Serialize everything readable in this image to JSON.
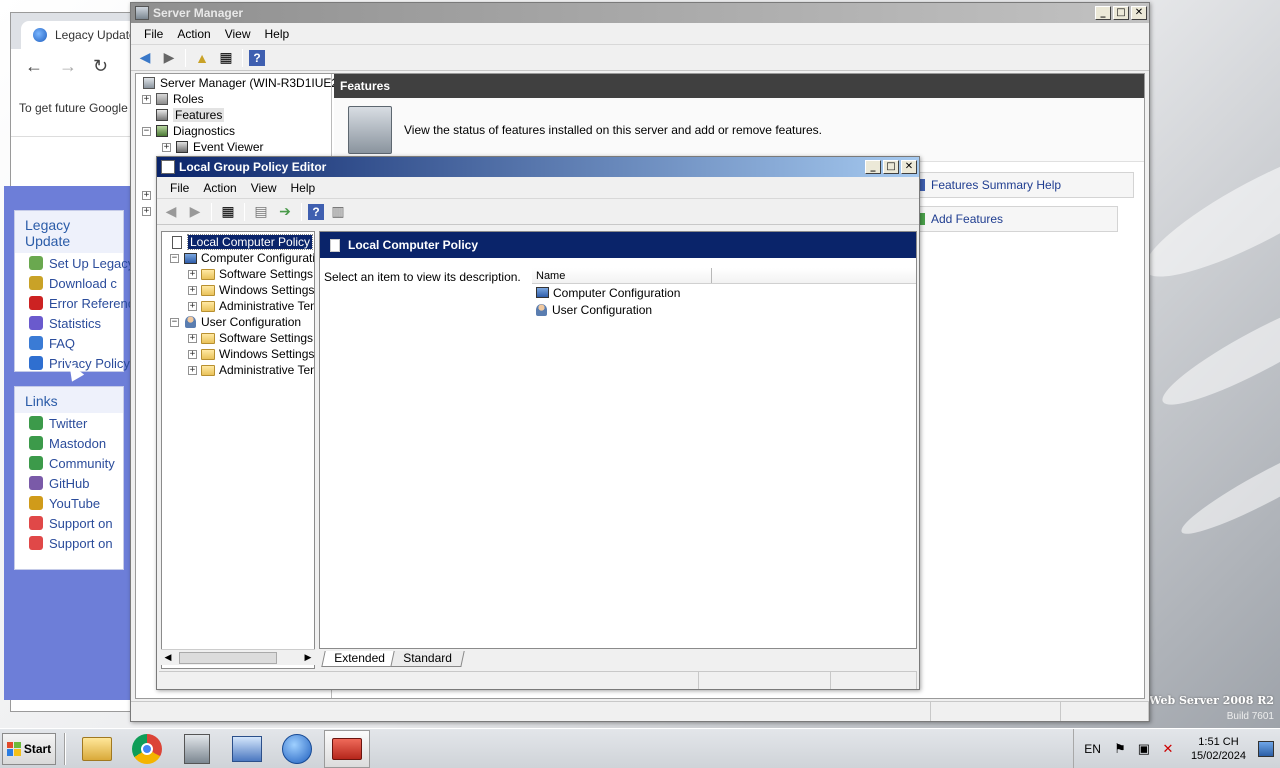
{
  "browser": {
    "tab_title": "Legacy Update",
    "infobar_text": "To get future Google",
    "sections": [
      {
        "title": "Legacy Update",
        "items": [
          {
            "label": "Set Up Legacy",
            "icon": "setup-icon",
            "color": "#6aa84f"
          },
          {
            "label": "Download c",
            "icon": "download-icon",
            "color": "#c9a227"
          },
          {
            "label": "Error Reference",
            "icon": "error-icon",
            "color": "#cc2222"
          },
          {
            "label": "Statistics",
            "icon": "statistics-icon",
            "color": "#6a5acd"
          },
          {
            "label": "FAQ",
            "icon": "faq-icon",
            "color": "#3a7bd5"
          },
          {
            "label": "Privacy Policy",
            "icon": "info-icon",
            "color": "#2f6fd0"
          }
        ]
      },
      {
        "title": "Links",
        "items": [
          {
            "label": "Twitter",
            "icon": "globe-icon",
            "color": "#3c9a4a"
          },
          {
            "label": "Mastodon",
            "icon": "globe-icon",
            "color": "#3c9a4a"
          },
          {
            "label": "Community",
            "icon": "users-icon",
            "color": "#3c9a4a"
          },
          {
            "label": "GitHub",
            "icon": "github-icon",
            "color": "#7a5aa8"
          },
          {
            "label": "YouTube",
            "icon": "youtube-icon",
            "color": "#d09b1a"
          },
          {
            "label": "Support on",
            "icon": "heart-icon",
            "color": "#e04848"
          },
          {
            "label": "Support on",
            "icon": "heart-icon",
            "color": "#e04848"
          }
        ]
      }
    ]
  },
  "server_manager": {
    "title": "Server Manager",
    "menu": [
      "File",
      "Action",
      "View",
      "Help"
    ],
    "tree": {
      "root": "Server Manager (WIN-R3D1IUE2IT",
      "items": [
        {
          "label": "Roles",
          "expander": "+"
        },
        {
          "label": "Features",
          "expander": ""
        },
        {
          "label": "Diagnostics",
          "expander": "−"
        },
        {
          "label": "Event Viewer",
          "expander": "+"
        }
      ]
    },
    "header": "Features",
    "description": "View the status of features installed on this server and add or remove features.",
    "actions": {
      "help_link": "Features Summary Help",
      "add_features": "Add Features"
    }
  },
  "gpedit": {
    "title": "Local Group Policy Editor",
    "menu": [
      "File",
      "Action",
      "View",
      "Help"
    ],
    "tree": {
      "root": "Local Computer Policy",
      "computer": "Computer Configuratio",
      "computer_children": [
        "Software Settings",
        "Windows Settings",
        "Administrative Tem"
      ],
      "user": "User Configuration",
      "user_children": [
        "Software Settings",
        "Windows Settings",
        "Administrative Tem"
      ]
    },
    "right_header": "Local Computer Policy",
    "description": "Select an item to view its description.",
    "list_column": "Name",
    "list_items": [
      "Computer Configuration",
      "User Configuration"
    ],
    "tabs": [
      "Extended",
      "Standard"
    ]
  },
  "taskbar": {
    "start_label": "Start",
    "apps": [
      "explorer-icon",
      "chrome-icon",
      "server-manager-icon",
      "control-panel-icon",
      "legacy-update-icon",
      "toolbox-icon"
    ],
    "language": "EN",
    "time": "1:51 CH",
    "date": "15/02/2024"
  },
  "wallpaper": {
    "brand": "Web Server 2008 R2",
    "build": "Build 7601"
  }
}
